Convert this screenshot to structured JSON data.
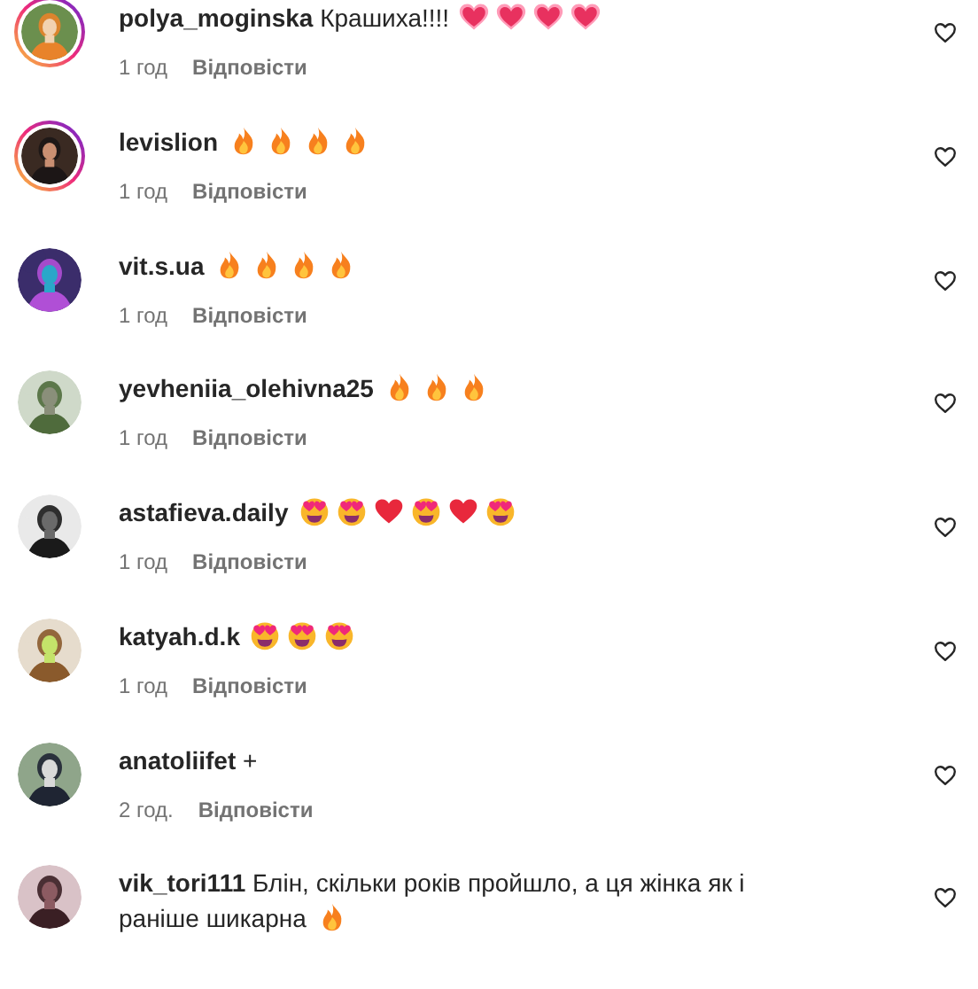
{
  "comments": [
    {
      "username": "polya_moginska",
      "text": "Крашиха!!!!",
      "reactions": [
        {
          "kind": "pink_heart"
        },
        {
          "kind": "pink_heart"
        },
        {
          "kind": "pink_heart"
        },
        {
          "kind": "pink_heart"
        }
      ],
      "story_ring": true,
      "time": "1 год",
      "reply": "Відповісти"
    },
    {
      "username": "levislion",
      "reactions": [
        {
          "kind": "fire"
        },
        {
          "kind": "fire"
        },
        {
          "kind": "fire"
        },
        {
          "kind": "fire"
        }
      ],
      "story_ring": true,
      "time": "1 год",
      "reply": "Відповісти"
    },
    {
      "username": "vit.s.ua",
      "reactions": [
        {
          "kind": "fire"
        },
        {
          "kind": "fire"
        },
        {
          "kind": "fire"
        },
        {
          "kind": "fire"
        }
      ],
      "story_ring": false,
      "time": "1 год",
      "reply": "Відповісти"
    },
    {
      "username": "yevheniia_olehivna25",
      "reactions": [
        {
          "kind": "fire"
        },
        {
          "kind": "fire"
        },
        {
          "kind": "fire"
        }
      ],
      "story_ring": false,
      "time": "1 год",
      "reply": "Відповісти"
    },
    {
      "username": "astafieva.daily",
      "reactions": [
        {
          "kind": "heart_eyes"
        },
        {
          "kind": "heart_eyes"
        },
        {
          "kind": "heart"
        },
        {
          "kind": "heart_eyes"
        },
        {
          "kind": "heart"
        },
        {
          "kind": "heart_eyes"
        }
      ],
      "story_ring": false,
      "time": "1 год",
      "reply": "Відповісти"
    },
    {
      "username": "katyah.d.k",
      "reactions": [
        {
          "kind": "heart_eyes"
        },
        {
          "kind": "heart_eyes"
        },
        {
          "kind": "heart_eyes"
        }
      ],
      "story_ring": false,
      "time": "1 год",
      "reply": "Відповісти"
    },
    {
      "username": "anatoliifet",
      "text": "+",
      "story_ring": false,
      "time": "2 год.",
      "reply": "Відповісти"
    },
    {
      "username": "vik_tori111",
      "text": "Блін, скільки років пройшло, а ця жінка як і раніше шикарна",
      "reactions": [
        {
          "kind": "fire"
        }
      ],
      "story_ring": false
    }
  ]
}
